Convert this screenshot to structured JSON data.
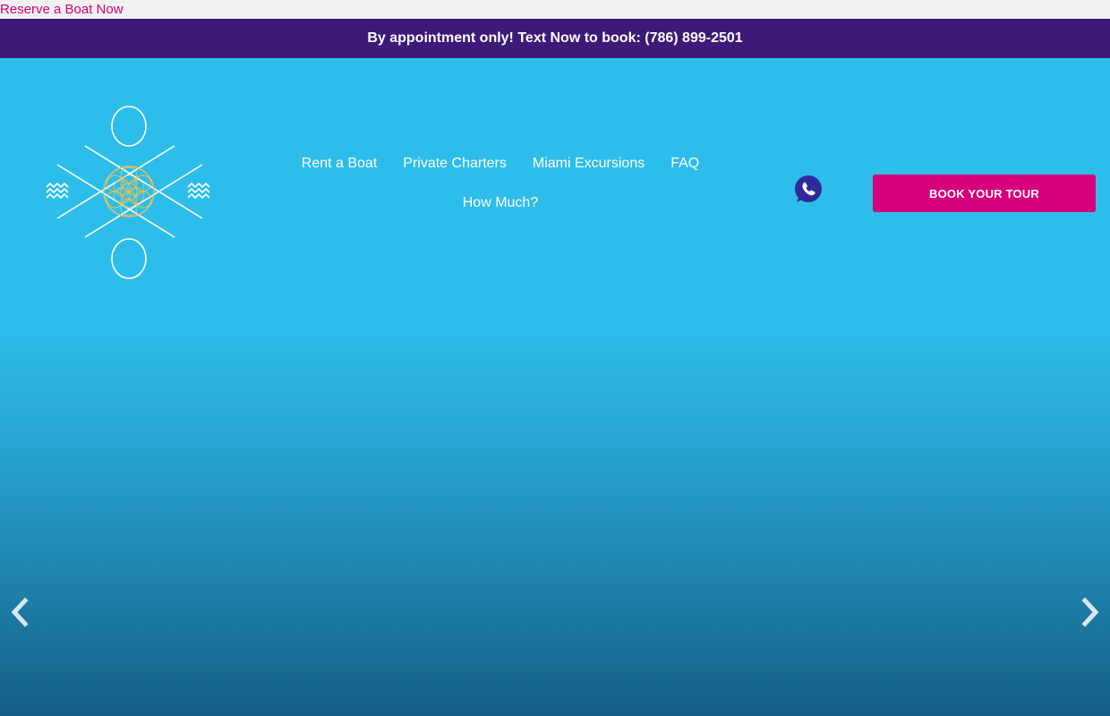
{
  "skip_link": {
    "label": "Reserve a Boat Now"
  },
  "announcement": {
    "text": "By appointment only! Text Now to book: (786) 899-2501"
  },
  "header": {
    "logo_icon": "flower-of-life-infinity-logo",
    "nav": [
      {
        "label": "Rent a Boat"
      },
      {
        "label": "Private Charters"
      },
      {
        "label": "Miami Excursions"
      },
      {
        "label": "FAQ"
      },
      {
        "label": "How Much?"
      }
    ],
    "whatsapp_icon": "whatsapp-icon",
    "cta_label": "BOOK YOUR TOUR"
  },
  "slider": {
    "prev_icon": "chevron-left-icon",
    "next_icon": "chevron-right-icon"
  },
  "colors": {
    "accent_pink": "#d6007a",
    "announce_purple": "#3d1a78",
    "header_cyan": "#2dbdea",
    "hero_bottom": "#155f86",
    "whatsapp_blue": "#2f2a9c"
  }
}
